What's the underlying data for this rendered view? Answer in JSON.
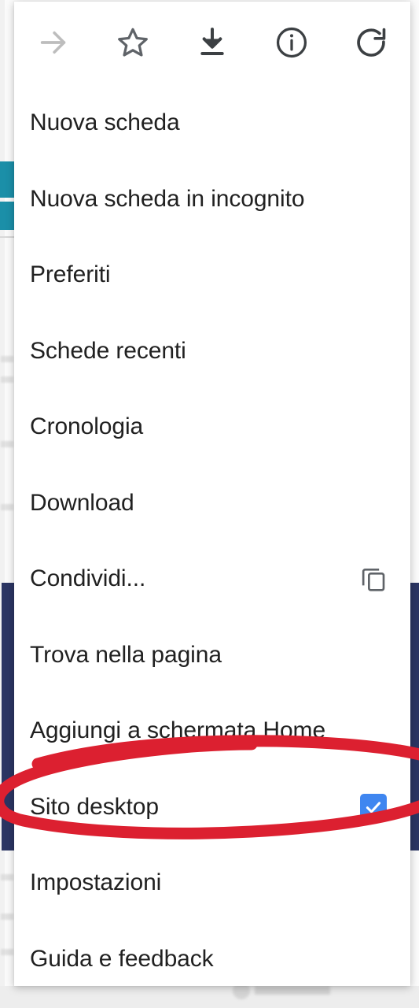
{
  "menu": {
    "toolbar": [
      {
        "name": "forward-icon",
        "label": "Avanti",
        "state": "disabled"
      },
      {
        "name": "bookmark-star-icon",
        "label": "Preferito",
        "state": "enabled"
      },
      {
        "name": "download-icon",
        "label": "Download",
        "state": "enabled"
      },
      {
        "name": "info-icon",
        "label": "Info pagina",
        "state": "enabled"
      },
      {
        "name": "reload-icon",
        "label": "Ricarica",
        "state": "enabled"
      }
    ],
    "items": [
      {
        "label": "Nuova scheda",
        "trailing": "none"
      },
      {
        "label": "Nuova scheda in incognito",
        "trailing": "none"
      },
      {
        "label": "Preferiti",
        "trailing": "none"
      },
      {
        "label": "Schede recenti",
        "trailing": "none"
      },
      {
        "label": "Cronologia",
        "trailing": "none"
      },
      {
        "label": "Download",
        "trailing": "none"
      },
      {
        "label": "Condividi...",
        "trailing": "copy-icon"
      },
      {
        "label": "Trova nella pagina",
        "trailing": "none"
      },
      {
        "label": "Aggiungi a schermata Home",
        "trailing": "none"
      },
      {
        "label": "Sito desktop",
        "trailing": "checkbox-checked"
      },
      {
        "label": "Impostazioni",
        "trailing": "none"
      },
      {
        "label": "Guida e feedback",
        "trailing": "none"
      }
    ]
  },
  "annotation": {
    "type": "hand-drawn-ellipse",
    "color": "#dc2030",
    "targets": "Sito desktop"
  },
  "colors": {
    "checkbox_blue": "#3f86f0",
    "annotation_red": "#dc2030",
    "menu_text": "#212121",
    "icon_grey": "#5f6368",
    "icon_disabled_grey": "#bdbdbd",
    "backdrop_navy": "#2b3563",
    "backdrop_teal": "#1b8fa8"
  }
}
